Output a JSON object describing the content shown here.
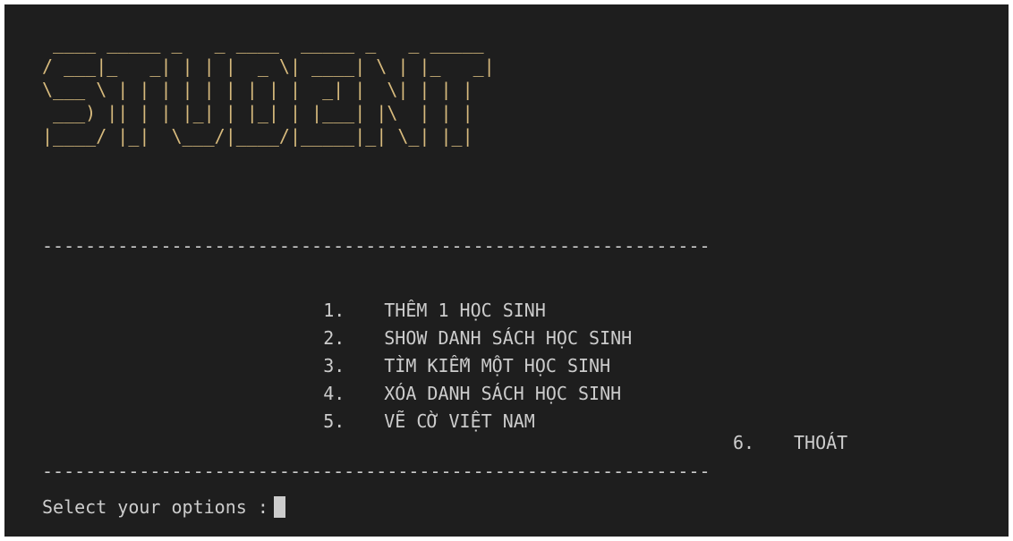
{
  "banner": {
    "ascii_art": " ____ _____ _   _ ____  _____ _   _ _____ \n/ ___|_   _| | | |  _ \\| ____| \\ | |_   _|\n\\___ \\ | | | | | | | | |  _| |  \\| | | |  \n ___) || | | |_| | |_| | |___| |\\  | | |  \n|____/ |_|  \\___/|____/|_____|_| \\_| |_|  ",
    "title_text": "STUDENT"
  },
  "divider": "--------------------------------------------------------------",
  "menu": {
    "items": [
      {
        "number": "1.",
        "label": "THÊM 1 HỌC SINH"
      },
      {
        "number": "2.",
        "label": "SHOW DANH SÁCH HỌC SINH"
      },
      {
        "number": "3.",
        "label": "TÌM KIẾM MỘT HỌC SINH"
      },
      {
        "number": "4.",
        "label": "XÓA DANH SÁCH HỌC SINH"
      },
      {
        "number": "5.",
        "label": "VẼ CỜ VIỆT NAM"
      }
    ],
    "exit": {
      "number": "6.",
      "label": "THOÁT"
    }
  },
  "prompt": {
    "text": "Select your options :"
  },
  "colors": {
    "background": "#1e1e1e",
    "text": "#cccccc",
    "banner": "#d7ba7d"
  }
}
